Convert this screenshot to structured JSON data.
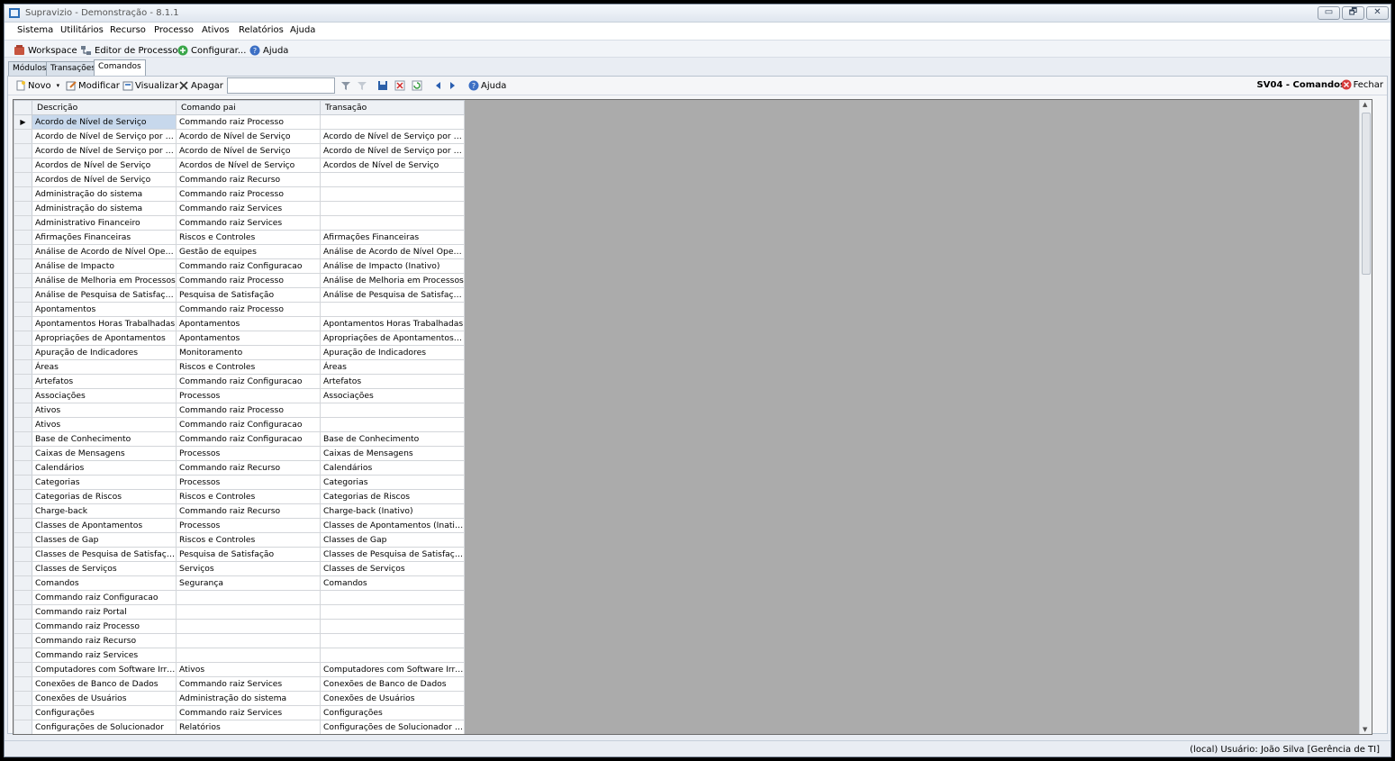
{
  "window": {
    "title": "Supravizio - Demonstração - 8.1.1",
    "buttons": [
      "▭",
      "🗗",
      "✕"
    ]
  },
  "menu": [
    "Sistema",
    "Utilitários",
    "Recurso",
    "Processo",
    "Ativos",
    "Relatórios",
    "Ajuda"
  ],
  "toolbar": [
    "Workspace",
    "Editor de Processos",
    "Configurar...",
    "Ajuda"
  ],
  "tabs": [
    "Módulos",
    "Transações",
    "Comandos"
  ],
  "actions": {
    "novo": "Novo",
    "modificar": "Modificar",
    "visualizar": "Visualizar",
    "apagar": "Apagar",
    "ajuda": "Ajuda",
    "screen_title": "SV04 - Comandos",
    "fechar": "Fechar"
  },
  "grid": {
    "columns": [
      "Descrição",
      "Comando pai",
      "Transação"
    ],
    "rows": [
      [
        "Acordo de Nível de Serviço",
        "Commando raiz Processo",
        ""
      ],
      [
        "Acordo de Nível de Serviço por Cliente",
        "Acordo de Nível de Serviço",
        "Acordo de Nível de Serviço por Cliente"
      ],
      [
        "Acordo de Nível de Serviço por Soluci...",
        "Acordo de Nível de Serviço",
        "Acordo de Nível de Serviço por Soluci..."
      ],
      [
        "Acordos de Nível de Serviço",
        "Acordos de Nível de Serviço",
        "Acordos de Nível de Serviço"
      ],
      [
        "Acordos de Nível de Serviço",
        "Commando raiz Recurso",
        ""
      ],
      [
        "Administração do sistema",
        "Commando raiz Processo",
        ""
      ],
      [
        "Administração do sistema",
        "Commando raiz Services",
        ""
      ],
      [
        "Administrativo Financeiro",
        "Commando raiz Services",
        ""
      ],
      [
        "Afirmações Financeiras",
        "Riscos e Controles",
        "Afirmações Financeiras"
      ],
      [
        "Análise de Acordo de Nível Operacional",
        "Gestão de equipes",
        "Análise de Acordo de Nível Operacional"
      ],
      [
        "Análise de Impacto",
        "Commando raiz Configuracao",
        "Análise de Impacto (Inativo)"
      ],
      [
        "Análise de Melhoria em Processos",
        "Commando raiz Processo",
        "Análise de Melhoria em Processos"
      ],
      [
        "Análise de Pesquisa de Satisfação por...",
        "Pesquisa de Satisfação",
        "Análise de Pesquisa de Satisfação por..."
      ],
      [
        "Apontamentos",
        "Commando raiz Processo",
        ""
      ],
      [
        "Apontamentos Horas Trabalhadas",
        "Apontamentos",
        "Apontamentos Horas Trabalhadas"
      ],
      [
        "Apropriações de Apontamentos",
        "Apontamentos",
        "Apropriações de Apontamentos (Inativo)"
      ],
      [
        "Apuração de Indicadores",
        "Monitoramento",
        "Apuração de Indicadores"
      ],
      [
        "Áreas",
        "Riscos e Controles",
        "Áreas"
      ],
      [
        "Artefatos",
        "Commando raiz Configuracao",
        "Artefatos"
      ],
      [
        "Associações",
        "Processos",
        "Associações"
      ],
      [
        "Ativos",
        "Commando raiz Processo",
        ""
      ],
      [
        "Ativos",
        "Commando raiz Configuracao",
        ""
      ],
      [
        "Base de Conhecimento",
        "Commando raiz Configuracao",
        "Base de Conhecimento"
      ],
      [
        "Caixas de Mensagens",
        "Processos",
        "Caixas de Mensagens"
      ],
      [
        "Calendários",
        "Commando raiz Recurso",
        "Calendários"
      ],
      [
        "Categorias",
        "Processos",
        "Categorias"
      ],
      [
        "Categorias de Riscos",
        "Riscos e Controles",
        "Categorias de Riscos"
      ],
      [
        "Charge-back",
        "Commando raiz Recurso",
        "Charge-back (Inativo)"
      ],
      [
        "Classes de Apontamentos",
        "Processos",
        "Classes de Apontamentos (Inativo)"
      ],
      [
        "Classes de Gap",
        "Riscos e Controles",
        "Classes de Gap"
      ],
      [
        "Classes de Pesquisa de Satisfação",
        "Pesquisa de Satisfação",
        "Classes de Pesquisa de Satisfação"
      ],
      [
        "Classes de Serviços",
        "Serviços",
        "Classes de Serviços"
      ],
      [
        "Comandos",
        "Segurança",
        "Comandos"
      ],
      [
        "Commando raiz Configuracao",
        "",
        ""
      ],
      [
        "Commando raiz Portal",
        "",
        ""
      ],
      [
        "Commando raiz Processo",
        "",
        ""
      ],
      [
        "Commando raiz Recurso",
        "",
        ""
      ],
      [
        "Commando raiz Services",
        "",
        ""
      ],
      [
        "Computadores com Software Irregular",
        "Ativos",
        "Computadores com Software Irregular"
      ],
      [
        "Conexões de Banco de Dados",
        "Commando raiz Services",
        "Conexões de Banco de Dados"
      ],
      [
        "Conexões de Usuários",
        "Administração do sistema",
        "Conexões de Usuários"
      ],
      [
        "Configurações",
        "Commando raiz Services",
        "Configurações"
      ],
      [
        "Configurações de Solucionador",
        "Relatórios",
        "Configurações de Solucionador (Inativo)"
      ]
    ]
  },
  "status": "(local)  Usuário: João Silva [Gerência de TI]",
  "colors": {
    "selection": "#c7d8ec",
    "grid_background": "#ababab",
    "chrome": "#e9edf3"
  }
}
